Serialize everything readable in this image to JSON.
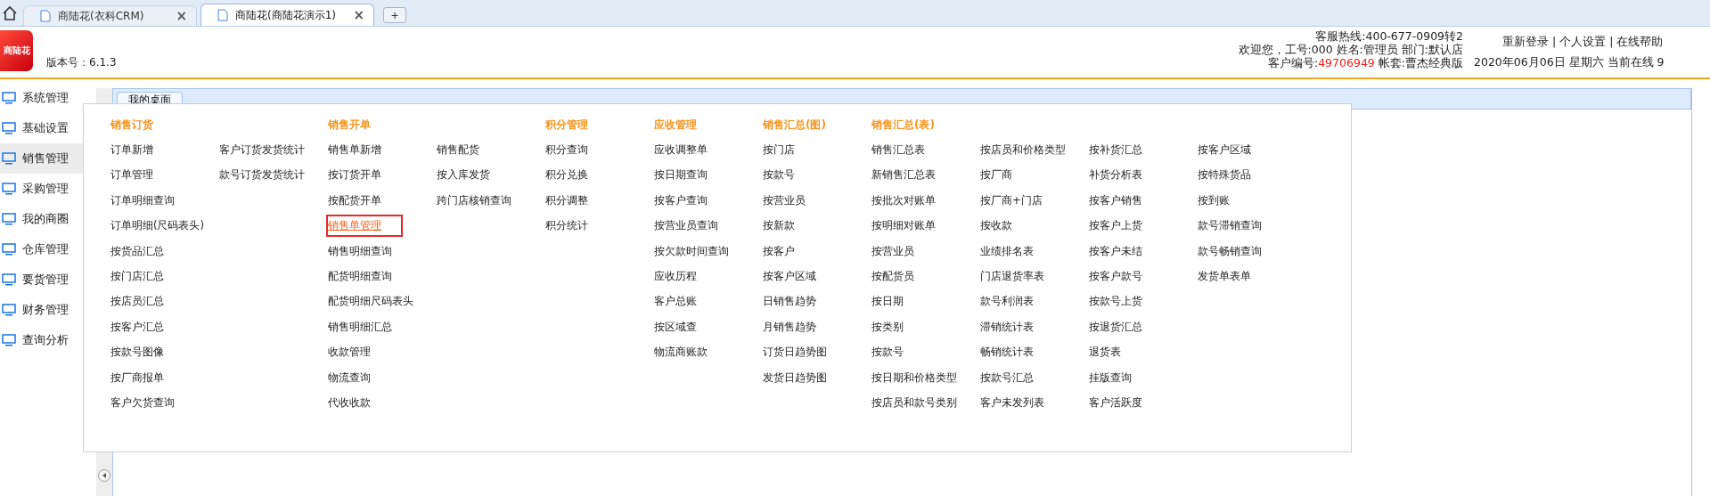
{
  "browser_tabs": [
    {
      "title": "商陆花(衣科CRM)",
      "close": "×",
      "selected": false
    },
    {
      "title": "商陆花(商陆花演示1)",
      "close": "×",
      "selected": true
    }
  ],
  "new_tab": "+",
  "header": {
    "logo": "商陆花",
    "version": "版本号：6.1.3",
    "hotline": "客服热线:400-677-0909转2",
    "welcome": "欢迎您，工号:000 姓名:管理员 部门:默认店",
    "customer_label": "客户编号:",
    "customer_no": "49706949",
    "account": "帐套:曹杰经典版",
    "links": [
      "重新登录",
      "个人设置",
      "在线帮助"
    ],
    "separator": "|",
    "date": "2020年06月06日 星期六 当前在线 9"
  },
  "sidebar": {
    "items": [
      {
        "label": "系统管理",
        "selected": false
      },
      {
        "label": "基础设置",
        "selected": false
      },
      {
        "label": "销售管理",
        "selected": true
      },
      {
        "label": "采购管理",
        "selected": false
      },
      {
        "label": "我的商圈",
        "selected": false
      },
      {
        "label": "仓库管理",
        "selected": false
      },
      {
        "label": "要货管理",
        "selected": false
      },
      {
        "label": "财务管理",
        "selected": false
      },
      {
        "label": "查询分析",
        "selected": false
      }
    ]
  },
  "content_tab": "我的桌面",
  "menu": {
    "groups": [
      {
        "title": "销售订货",
        "columns": [
          [
            {
              "label": "订单新增",
              "selected": false
            },
            {
              "label": "订单管理",
              "selected": false
            },
            {
              "label": "订单明细查询",
              "selected": false
            },
            {
              "label": "订单明细(尺码表头)",
              "selected": false
            },
            {
              "label": "按货品汇总",
              "selected": false
            },
            {
              "label": "按门店汇总",
              "selected": false
            },
            {
              "label": "按店员汇总",
              "selected": false
            },
            {
              "label": "按客户汇总",
              "selected": false
            },
            {
              "label": "按款号图像",
              "selected": false
            },
            {
              "label": "按厂商报单",
              "selected": false
            },
            {
              "label": "客户欠货查询",
              "selected": false
            }
          ],
          [
            {
              "label": "客户订货发货统计",
              "selected": false
            },
            {
              "label": "款号订货发货统计",
              "selected": false
            }
          ]
        ]
      },
      {
        "title": "销售开单",
        "columns": [
          [
            {
              "label": "销售单新增",
              "selected": false
            },
            {
              "label": "按订货开单",
              "selected": false
            },
            {
              "label": "按配货开单",
              "selected": false
            },
            {
              "label": "销售单管理",
              "selected": true
            },
            {
              "label": "销售明细查询",
              "selected": false
            },
            {
              "label": "配货明细查询",
              "selected": false
            },
            {
              "label": "配货明细尺码表头",
              "selected": false
            },
            {
              "label": "销售明细汇总",
              "selected": false
            },
            {
              "label": "收款管理",
              "selected": false
            },
            {
              "label": "物流查询",
              "selected": false
            },
            {
              "label": "代收收款",
              "selected": false
            }
          ],
          [
            {
              "label": "销售配货",
              "selected": false
            },
            {
              "label": "按入库发货",
              "selected": false
            },
            {
              "label": "跨门店核销查询",
              "selected": false
            }
          ]
        ]
      },
      {
        "title": "积分管理",
        "columns": [
          [
            {
              "label": "积分查询",
              "selected": false
            },
            {
              "label": "积分兑换",
              "selected": false
            },
            {
              "label": "积分调整",
              "selected": false
            },
            {
              "label": "积分统计",
              "selected": false
            }
          ]
        ]
      },
      {
        "title": "应收管理",
        "columns": [
          [
            {
              "label": "应收调整单",
              "selected": false
            },
            {
              "label": "按日期查询",
              "selected": false
            },
            {
              "label": "按客户查询",
              "selected": false
            },
            {
              "label": "按营业员查询",
              "selected": false
            },
            {
              "label": "按欠款时间查询",
              "selected": false
            },
            {
              "label": "应收历程",
              "selected": false
            },
            {
              "label": "客户总账",
              "selected": false
            },
            {
              "label": "按区域查",
              "selected": false
            },
            {
              "label": "物流商账款",
              "selected": false
            }
          ]
        ]
      },
      {
        "title": "销售汇总(图)",
        "columns": [
          [
            {
              "label": "按门店",
              "selected": false
            },
            {
              "label": "按款号",
              "selected": false
            },
            {
              "label": "按营业员",
              "selected": false
            },
            {
              "label": "按新款",
              "selected": false
            },
            {
              "label": "按客户",
              "selected": false
            },
            {
              "label": "按客户区域",
              "selected": false
            },
            {
              "label": "日销售趋势",
              "selected": false
            },
            {
              "label": "月销售趋势",
              "selected": false
            },
            {
              "label": "订货日趋势图",
              "selected": false
            },
            {
              "label": "发货日趋势图",
              "selected": false
            }
          ]
        ]
      },
      {
        "title": "销售汇总(表)",
        "columns": [
          [
            {
              "label": "销售汇总表",
              "selected": false
            },
            {
              "label": "新销售汇总表",
              "selected": false
            },
            {
              "label": "按批次对账单",
              "selected": false
            },
            {
              "label": "按明细对账单",
              "selected": false
            },
            {
              "label": "按营业员",
              "selected": false
            },
            {
              "label": "按配货员",
              "selected": false
            },
            {
              "label": "按日期",
              "selected": false
            },
            {
              "label": "按类别",
              "selected": false
            },
            {
              "label": "按款号",
              "selected": false
            },
            {
              "label": "按日期和价格类型",
              "selected": false
            },
            {
              "label": "按店员和款号类别",
              "selected": false
            }
          ],
          [
            {
              "label": "按店员和价格类型",
              "selected": false
            },
            {
              "label": "按厂商",
              "selected": false
            },
            {
              "label": "按厂商+门店",
              "selected": false
            },
            {
              "label": "按收款",
              "selected": false
            },
            {
              "label": "业绩排名表",
              "selected": false
            },
            {
              "label": "门店退货率表",
              "selected": false
            },
            {
              "label": "款号利润表",
              "selected": false
            },
            {
              "label": "滞销统计表",
              "selected": false
            },
            {
              "label": "畅销统计表",
              "selected": false
            },
            {
              "label": "按款号汇总",
              "selected": false
            },
            {
              "label": "客户未发列表",
              "selected": false
            }
          ],
          [
            {
              "label": "按补货汇总",
              "selected": false
            },
            {
              "label": "补货分析表",
              "selected": false
            },
            {
              "label": "按客户销售",
              "selected": false
            },
            {
              "label": "按客户上货",
              "selected": false
            },
            {
              "label": "按客户未结",
              "selected": false
            },
            {
              "label": "按客户款号",
              "selected": false
            },
            {
              "label": "按款号上货",
              "selected": false
            },
            {
              "label": "按退货汇总",
              "selected": false
            },
            {
              "label": "退货表",
              "selected": false
            },
            {
              "label": "挂版查询",
              "selected": false
            },
            {
              "label": "客户活跃度",
              "selected": false
            }
          ],
          [
            {
              "label": "按客户区域",
              "selected": false
            },
            {
              "label": "按特殊货品",
              "selected": false
            },
            {
              "label": "按到账",
              "selected": false
            },
            {
              "label": "款号滞销查询",
              "selected": false
            },
            {
              "label": "款号畅销查询",
              "selected": false
            },
            {
              "label": "发货单表单",
              "selected": false
            }
          ]
        ]
      }
    ]
  }
}
